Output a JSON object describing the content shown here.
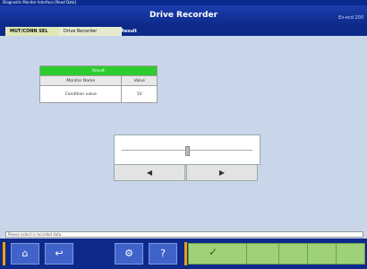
{
  "window": {
    "title": "Diagnostic Monitor Interface [Read Data]"
  },
  "header": {
    "title": "Drive Recorder",
    "right_text": "Ev-ecd 200"
  },
  "tabs": [
    {
      "label": "MUT/CONN SEL"
    },
    {
      "label": "Drive Recorder"
    },
    {
      "label": "Result"
    }
  ],
  "pid_table": {
    "header": "Result",
    "columns": [
      "Monitor Name",
      "Value"
    ],
    "rows": [
      {
        "name": "Condition value",
        "value": "1V"
      }
    ]
  },
  "slider": {
    "position": 0.5
  },
  "nav": {
    "prev_icon": "◀",
    "next_icon": "▶"
  },
  "status": {
    "text": "Please select a recorded data"
  },
  "footer": {
    "home_icon": "⌂",
    "back_icon": "↩",
    "print_icon": "⚙",
    "help_icon": "?",
    "ok_icon": "✓"
  }
}
